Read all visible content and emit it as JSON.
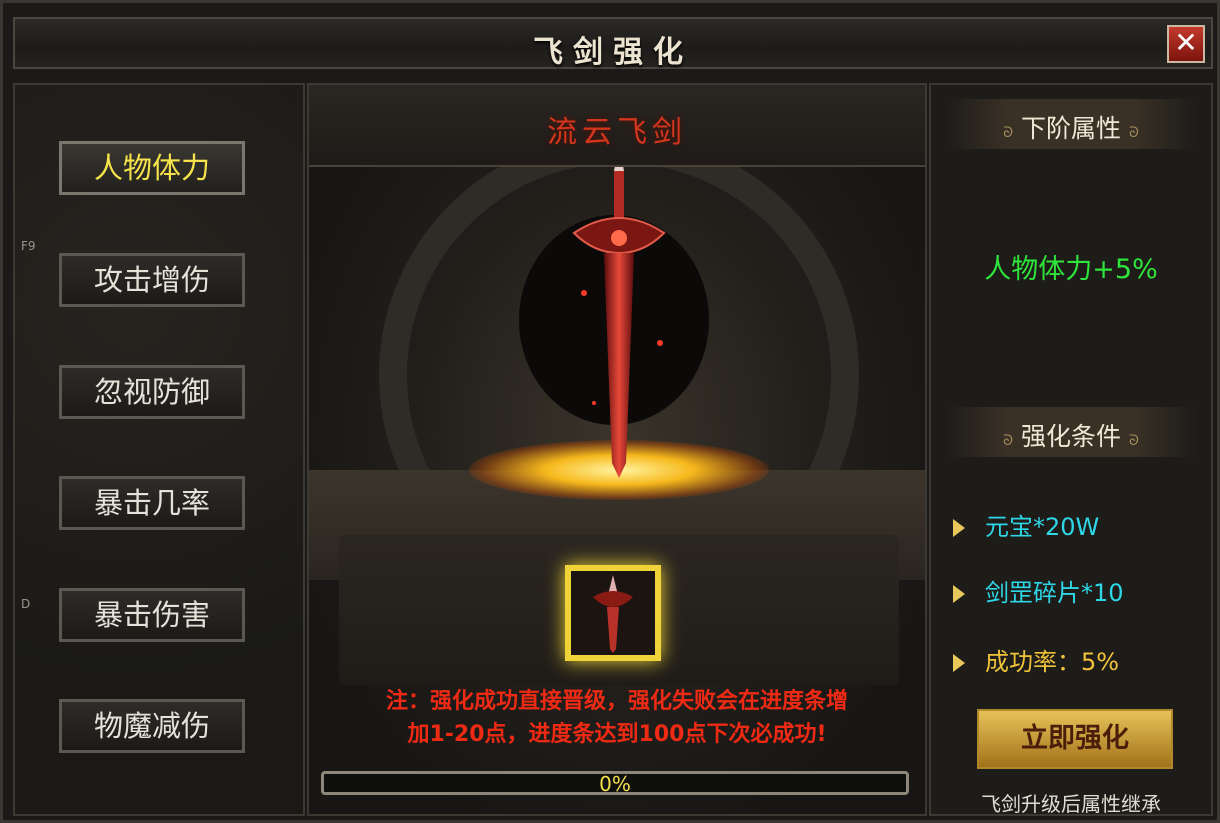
{
  "window": {
    "title": "飞剑强化",
    "close_label": "✕"
  },
  "left": {
    "tabs": [
      {
        "label": "人物体力",
        "active": true
      },
      {
        "label": "攻击增伤",
        "active": false
      },
      {
        "label": "忽视防御",
        "active": false
      },
      {
        "label": "暴击几率",
        "active": false
      },
      {
        "label": "暴击伤害",
        "active": false
      },
      {
        "label": "物魔减伤",
        "active": false
      }
    ],
    "hotkeys": [
      "F9",
      "D"
    ]
  },
  "center": {
    "sword_name": "流云飞剑",
    "notice_line1": "注：强化成功直接晋级，强化失败会在进度条增",
    "notice_line2": "加1-20点，进度条达到100点下次必成功!",
    "progress": {
      "value": 0,
      "label": "0%"
    }
  },
  "right": {
    "next_attr_title": "下阶属性",
    "next_attr_value": "人物体力+5%",
    "cond_title": "强化条件",
    "conditions": [
      "元宝*20W",
      "剑罡碎片*10",
      "成功率：5%"
    ],
    "enhance_button": "立即强化",
    "footer": "飞剑升级后属性继承"
  },
  "colors": {
    "active_tab": "#f6e24a",
    "attr_green": "#2fe43a",
    "cond_cyan": "#2ed6e6",
    "notice_red": "#ef2a14"
  }
}
